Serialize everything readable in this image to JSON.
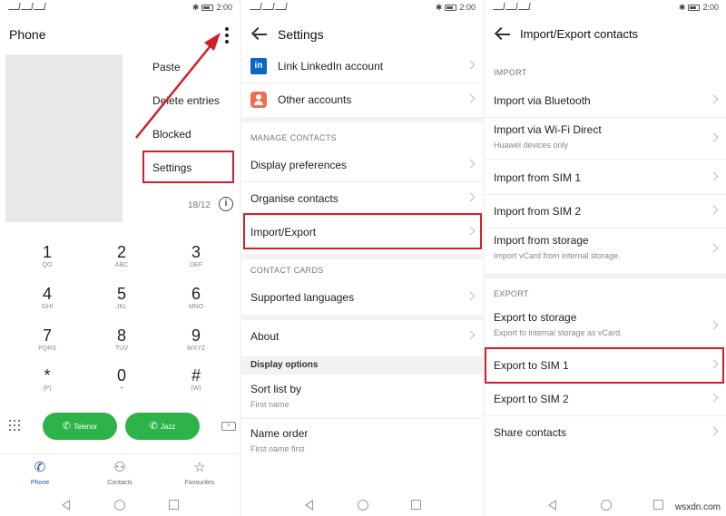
{
  "status": {
    "time": "2:00",
    "bt": "✱"
  },
  "phone": {
    "title": "Phone",
    "menu": [
      "Paste",
      "Delete entries",
      "Blocked",
      "Settings"
    ],
    "date_readout": "18/12",
    "keys": [
      {
        "num": "1",
        "letters": "QO"
      },
      {
        "num": "2",
        "letters": "ABC"
      },
      {
        "num": "3",
        "letters": "DEF"
      },
      {
        "num": "4",
        "letters": "GHI"
      },
      {
        "num": "5",
        "letters": "JKL"
      },
      {
        "num": "6",
        "letters": "MNO"
      },
      {
        "num": "7",
        "letters": "PQRS"
      },
      {
        "num": "8",
        "letters": "TUV"
      },
      {
        "num": "9",
        "letters": "WXYZ"
      },
      {
        "num": "*",
        "letters": "(P)"
      },
      {
        "num": "0",
        "letters": "+"
      },
      {
        "num": "#",
        "letters": "(W)"
      }
    ],
    "call_buttons": [
      "Telenor",
      "Jazz"
    ],
    "nav": [
      {
        "label": "Phone",
        "icon": "phone-icon"
      },
      {
        "label": "Contacts",
        "icon": "contacts-icon"
      },
      {
        "label": "Favourites",
        "icon": "star-icon"
      }
    ]
  },
  "settings": {
    "title": "Settings",
    "linkedin": "Link LinkedIn account",
    "other_accounts": "Other accounts",
    "manage_section": "MANAGE CONTACTS",
    "display_preferences": "Display preferences",
    "organise": "Organise contacts",
    "import_export": "Import/Export",
    "cards_section": "CONTACT CARDS",
    "languages": "Supported languages",
    "about": "About",
    "display_options": "Display options",
    "sort_by": "Sort list by",
    "sort_by_value": "First name",
    "name_order": "Name order",
    "name_order_value": "First name first"
  },
  "import_export": {
    "title": "Import/Export contacts",
    "import_section": "IMPORT",
    "via_bluetooth": "Import via Bluetooth",
    "via_wifi": "Import via Wi-Fi Direct",
    "via_wifi_sub": "Huawei devices only",
    "from_sim1": "Import from SIM 1",
    "from_sim2": "Import from SIM 2",
    "from_storage": "Import from storage",
    "from_storage_sub": "Import vCard from internal storage.",
    "export_section": "EXPORT",
    "to_storage": "Export to storage",
    "to_storage_sub": "Export to internal storage as vCard.",
    "to_sim1": "Export to SIM 1",
    "to_sim2": "Export to SIM 2",
    "share": "Share contacts"
  },
  "watermark": "wsxdn.com",
  "colors": {
    "highlight": "#d0202a",
    "call_green": "#2db34a",
    "nav_active": "#1f4fb0"
  }
}
